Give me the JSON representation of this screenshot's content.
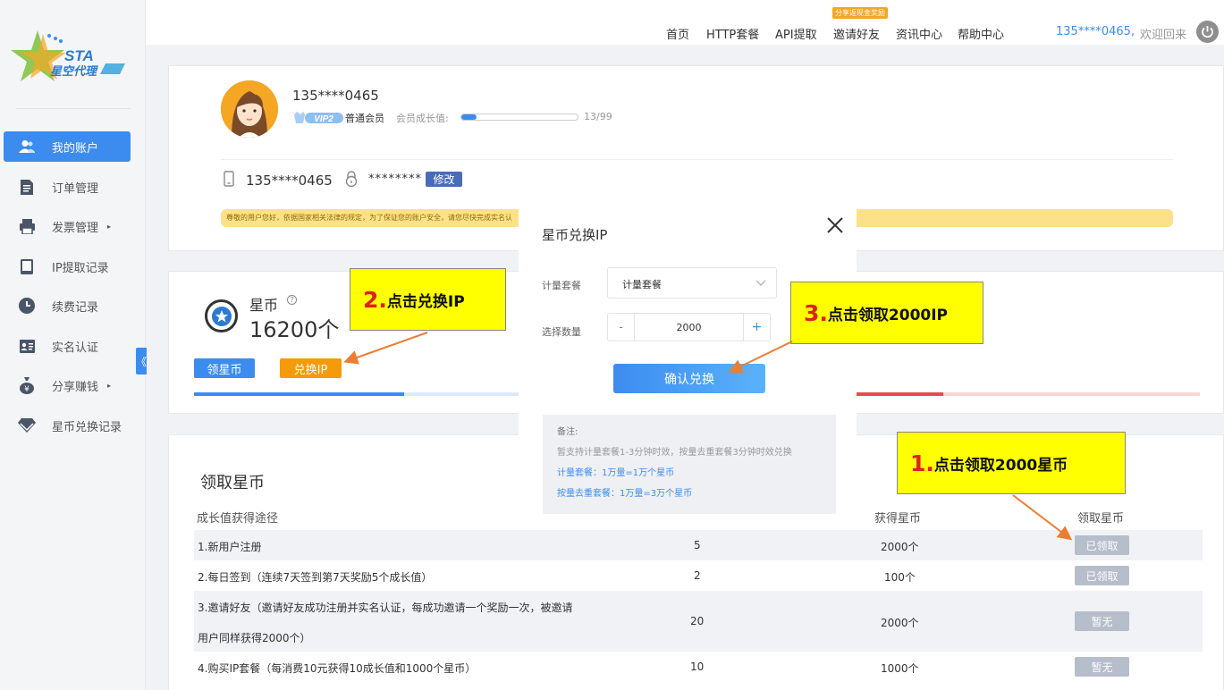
{
  "brand": {
    "logo_text": "STA",
    "logo_cn": "星空代理"
  },
  "sidebar": {
    "items": [
      {
        "label": "我的账户",
        "icon": "user-icon",
        "active": true
      },
      {
        "label": "订单管理",
        "icon": "document-icon"
      },
      {
        "label": "发票管理",
        "icon": "printer-icon",
        "has_submenu": true
      },
      {
        "label": "IP提取记录",
        "icon": "tablet-icon"
      },
      {
        "label": "续费记录",
        "icon": "clock-icon"
      },
      {
        "label": "实名认证",
        "icon": "id-card-icon"
      },
      {
        "label": "分享赚钱",
        "icon": "money-bag-icon",
        "has_submenu": true
      },
      {
        "label": "星币兑换记录",
        "icon": "diamond-icon"
      }
    ],
    "collapse_label": "《",
    "caret": "▸"
  },
  "topnav": {
    "items": [
      "首页",
      "HTTP套餐",
      "API提取",
      "邀请好友",
      "资讯中心",
      "帮助中心"
    ],
    "promo_badge": "分享返现金奖励",
    "user_phone": "135****0465,",
    "welcome": "欢迎回来"
  },
  "account": {
    "phone": "135****0465",
    "vip_label": "VIP2",
    "member_type": "普通会员",
    "growth_label": "会员成长值:",
    "growth_text": "13/99",
    "growth_progress": 0.13,
    "phone_masked": "135****0465",
    "password_masked": "********",
    "modify_label": "修改",
    "notice": "尊敬的用户您好，依据国家相关法律的规定，为了保证您的账户安全，请您尽快完成实名认"
  },
  "coins": {
    "label": "星币",
    "help": "?",
    "amount": "16200个",
    "get_coins_label": "领星币",
    "exchange_label": "兑换IP"
  },
  "table": {
    "title": "领取星币",
    "headers": [
      "成长值获得途径",
      "获得星币",
      "领取星币"
    ],
    "rows": [
      {
        "desc": "1.新用户注册",
        "growth": "5",
        "coins": "2000个",
        "status": "已领取"
      },
      {
        "desc": "2.每日签到（连续7天签到第7天奖励5个成长值）",
        "growth": "2",
        "coins": "100个",
        "status": "已领取"
      },
      {
        "desc_line1": "3.邀请好友（邀请好友成功注册并实名认证，每成功邀请一个奖励一次，被邀请",
        "desc_line2": "用户同样获得2000个）",
        "growth": "20",
        "coins": "2000个",
        "status": "暂无"
      },
      {
        "desc": "4.购买IP套餐（每消费10元获得10成长值和1000个星币）",
        "growth": "10",
        "coins": "1000个",
        "status": "暂无"
      }
    ]
  },
  "modal": {
    "title": "星币兑换IP",
    "package_label": "计量套餐",
    "package_value": "计量套餐",
    "qty_label": "选择数量",
    "qty_minus": "-",
    "qty_value": "2000",
    "qty_plus": "+",
    "confirm_label": "确认兑换",
    "notes": {
      "heading": "备注:",
      "line1": "暂支持计量套餐1-3分钟时效，按量去重套餐3分钟时效兑换",
      "line2": "计量套餐：1万量=1万个星币",
      "line3": "按量去重套餐：1万量=3万个星币"
    }
  },
  "callouts": [
    {
      "num": "2.",
      "text": "点击兑换IP"
    },
    {
      "num": "3.",
      "text": "点击领取2000IP"
    },
    {
      "num": "1.",
      "text": "点击领取2000星币"
    }
  ],
  "colors": {
    "accent": "#3c8cf0",
    "orange": "#f59a0a",
    "callout": "#ffff00",
    "badge_grey": "#b6bdcb"
  }
}
